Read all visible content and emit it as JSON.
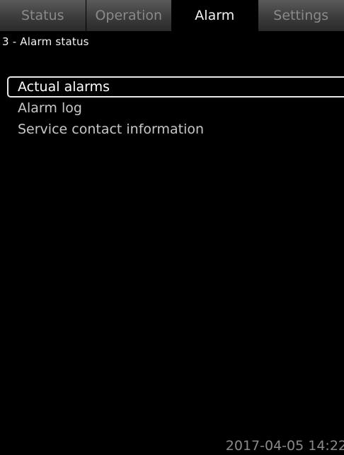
{
  "tabs": [
    {
      "label": "Status",
      "active": false
    },
    {
      "label": "Operation",
      "active": false
    },
    {
      "label": "Alarm",
      "active": true
    },
    {
      "label": "Settings",
      "active": false
    }
  ],
  "breadcrumb": "3 - Alarm status",
  "menu": {
    "items": [
      {
        "label": "Actual alarms",
        "selected": true
      },
      {
        "label": "Alarm log",
        "selected": false
      },
      {
        "label": "Service contact information",
        "selected": false
      }
    ]
  },
  "footer": {
    "timestamp": "2017-04-05 14:22"
  }
}
